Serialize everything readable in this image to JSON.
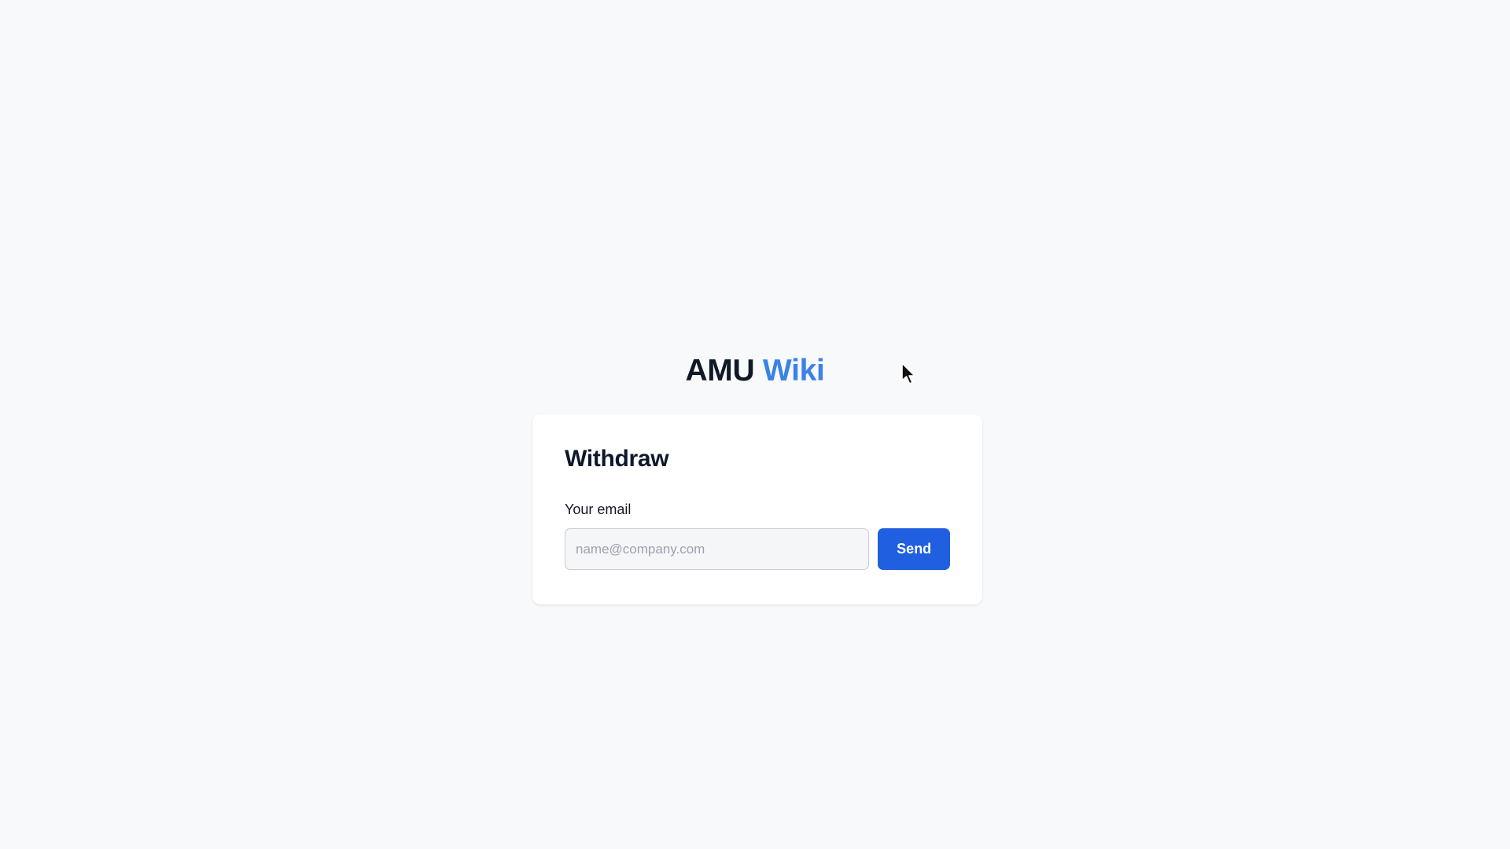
{
  "brand": {
    "name_part1": "AMU",
    "name_part2": "Wiki"
  },
  "form": {
    "title": "Withdraw",
    "email_label": "Your email",
    "email_value": "",
    "email_placeholder": "name@company.com",
    "submit_label": "Send"
  },
  "colors": {
    "background": "#f8f9fa",
    "brand_text": "#111827",
    "brand_accent": "#3b82e6",
    "button": "#1f5fe0"
  },
  "icons": {
    "cursor": "mouse-pointer-icon"
  }
}
